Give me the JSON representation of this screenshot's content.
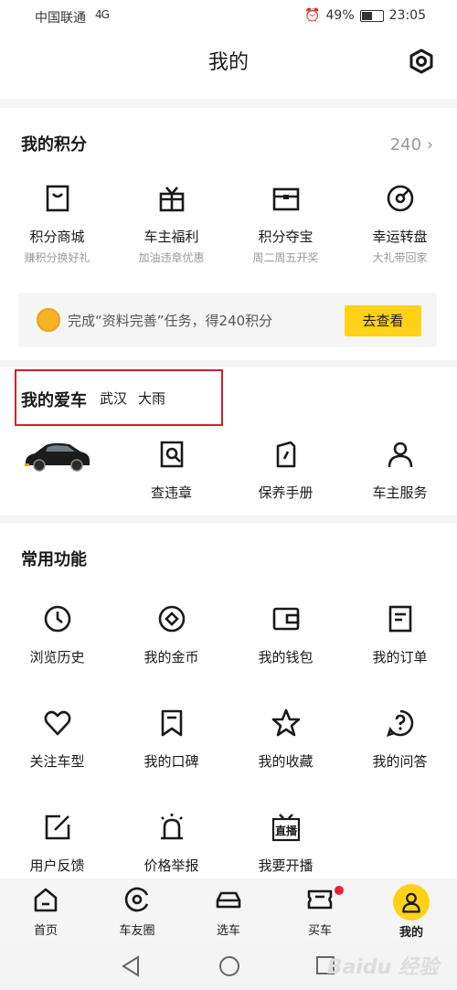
{
  "status": {
    "carrier": "中国联通",
    "signal": "4G",
    "battery": "49%",
    "time": "23:05"
  },
  "header": {
    "title": "我的"
  },
  "points": {
    "title": "我的积分",
    "value": "240",
    "items": [
      {
        "label": "积分商城",
        "sub": "赚积分换好礼",
        "icon": "bag-icon"
      },
      {
        "label": "车主福利",
        "sub": "加油违章优惠",
        "icon": "gift-icon"
      },
      {
        "label": "积分夺宝",
        "sub": "周二周五开奖",
        "icon": "treasure-box-icon"
      },
      {
        "label": "幸运转盘",
        "sub": "大礼带回家",
        "icon": "spin-wheel-icon"
      }
    ],
    "banner": {
      "text": "完成“资料完善”任务，得240积分",
      "button": "去查看"
    }
  },
  "mycar": {
    "title": "我的爱车",
    "city": "武汉",
    "weather": "大雨",
    "items": [
      {
        "label": "查违章",
        "icon": "search-violation-icon"
      },
      {
        "label": "保养手册",
        "icon": "maintenance-icon"
      },
      {
        "label": "车主服务",
        "icon": "person-icon"
      }
    ]
  },
  "common": {
    "title": "常用功能",
    "items": [
      {
        "label": "浏览历史",
        "icon": "clock-icon"
      },
      {
        "label": "我的金币",
        "icon": "coin-icon"
      },
      {
        "label": "我的钱包",
        "icon": "wallet-icon"
      },
      {
        "label": "我的订单",
        "icon": "order-icon"
      },
      {
        "label": "关注车型",
        "icon": "heart-icon"
      },
      {
        "label": "我的口碑",
        "icon": "bookmark-icon"
      },
      {
        "label": "我的收藏",
        "icon": "star-icon"
      },
      {
        "label": "我的问答",
        "icon": "question-icon"
      },
      {
        "label": "用户反馈",
        "icon": "edit-icon"
      },
      {
        "label": "价格举报",
        "icon": "alarm-icon"
      },
      {
        "label": "我要开播",
        "icon": "live-icon"
      }
    ]
  },
  "tabs": [
    {
      "label": "首页",
      "icon": "home-icon"
    },
    {
      "label": "车友圈",
      "icon": "circle-icon"
    },
    {
      "label": "选车",
      "icon": "car-icon"
    },
    {
      "label": "买车",
      "icon": "ticket-icon"
    },
    {
      "label": "我的",
      "icon": "profile-icon"
    }
  ],
  "colors": {
    "accent": "#ffd219",
    "highlight": "#d0202a",
    "badge": "#e8242e"
  },
  "watermark": "Baidu 经验"
}
